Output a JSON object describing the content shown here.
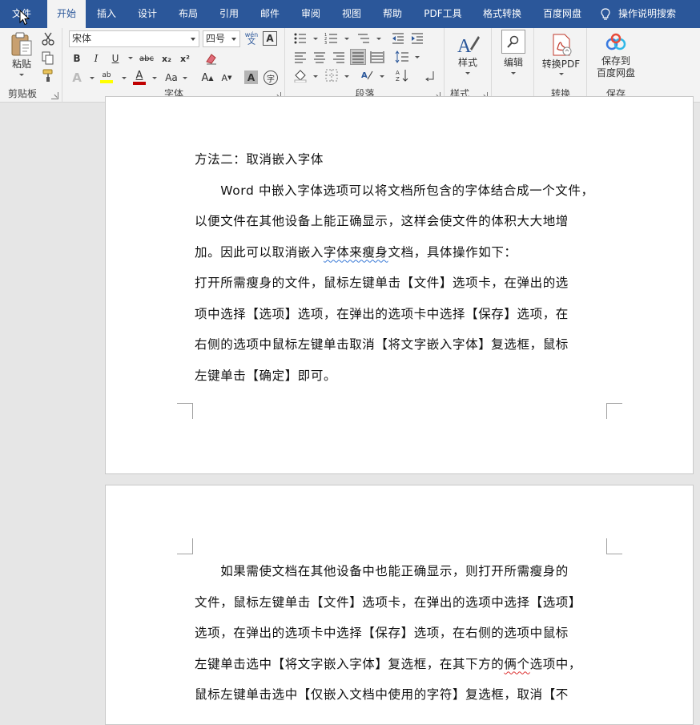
{
  "menu": {
    "tabs": [
      "文件",
      "开始",
      "插入",
      "设计",
      "布局",
      "引用",
      "邮件",
      "审阅",
      "视图",
      "帮助",
      "PDF工具",
      "格式转换",
      "百度网盘"
    ],
    "active": "开始",
    "tell_me": "操作说明搜索"
  },
  "ribbon": {
    "clipboard": {
      "label": "剪贴板",
      "paste": "粘贴"
    },
    "font": {
      "label": "字体",
      "font_name": "宋体",
      "font_size": "四号",
      "phonetic_top": "wén",
      "phonetic_bottom": "文",
      "bold": "B",
      "italic": "I",
      "underline": "U",
      "strike": "abc",
      "sub": "x₂",
      "sup": "x²",
      "grow": "A",
      "shrink": "A",
      "change_case": "Aa",
      "char_shade": "A",
      "enclose": "字"
    },
    "paragraph": {
      "label": "段落"
    },
    "styles": {
      "label": "样式",
      "button": "样式"
    },
    "editing": {
      "button": "编辑"
    },
    "convert": {
      "label": "转换",
      "button": "转换PDF"
    },
    "save": {
      "label": "保存",
      "button_line1": "保存到",
      "button_line2": "百度网盘"
    }
  },
  "document": {
    "page1": {
      "heading": "方法二：取消嵌入字体",
      "para1": [
        "　　Word 中嵌入字体选项可以将文档所包含的字体结合成一个文件，",
        "以便文件在其他设备上能正确显示，这样会使文件的体积大大地增",
        [
          "加。因此可以取消嵌入",
          "字体来瘦身",
          "文档，具体操作如下："
        ]
      ],
      "para2": [
        "打开所需瘦身的文件，鼠标左键单击【文件】选项卡，在弹出的选",
        "项中选择【选项】选项，在弹出的选项卡中选择【保存】选项，在",
        "右侧的选项中鼠标左键单击取消【将文字嵌入字体】复选框，鼠标",
        "左键单击【确定】即可。"
      ]
    },
    "page2": {
      "para": [
        "　　如果需使文档在其他设备中也能正确显示，则打开所需瘦身的",
        "文件，鼠标左键单击【文件】选项卡，在弹出的选项中选择【选项】",
        "选项，在弹出的选项卡中选择【保存】选项，在右侧的选项中鼠标",
        [
          "左键单击选中【将文字嵌入字体】复选框，在其下方的",
          "俩个",
          "选项中，"
        ],
        "鼠标左键单击选中【仅嵌入文档中使用的字符】复选框，取消【不"
      ]
    }
  }
}
